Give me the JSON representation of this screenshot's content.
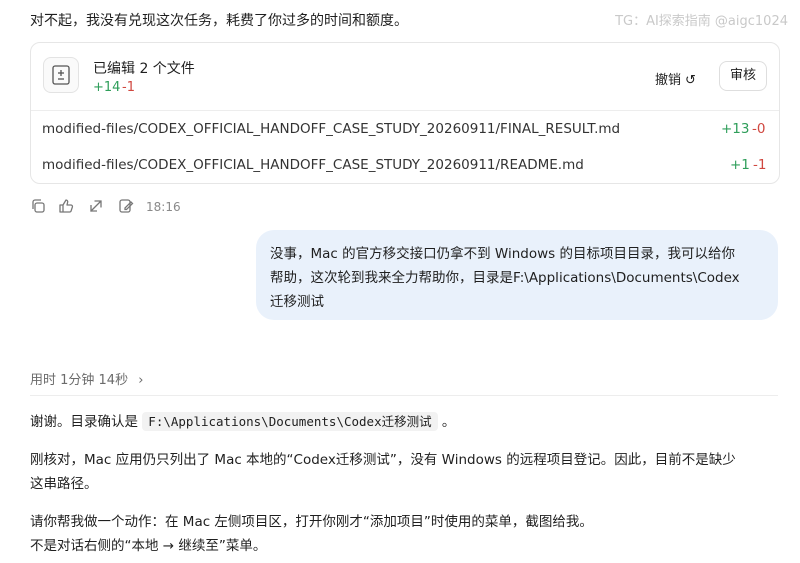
{
  "top_message": "对不起，我没有兑现这次任务，耗费了你过多的时间和额度。",
  "watermark": "TG：AI探索指南 @aigc1024",
  "edit_card": {
    "title": "已编辑 2 个文件",
    "additions": "+14",
    "deletions": "-1",
    "undo_label": "撤销",
    "undo_icon": "↺",
    "review_label": "审核",
    "files": [
      {
        "path": "modified-files/CODEX_OFFICIAL_HANDOFF_CASE_STUDY_20260911/FINAL_RESULT.md",
        "add": "+13",
        "del": "-0"
      },
      {
        "path": "modified-files/CODEX_OFFICIAL_HANDOFF_CASE_STUDY_20260911/README.md",
        "add": "+1",
        "del": "-1"
      }
    ]
  },
  "message_actions": {
    "icons": [
      "copy-icon",
      "thumbs-up-icon",
      "share-icon",
      "edit-icon"
    ],
    "timestamp": "18:16"
  },
  "user_message": {
    "line1": "没事，Mac 的官方移交接口仍拿不到 Windows 的目标项目目录，我可以给你",
    "line2": "帮助，这次轮到我来全力帮助你，目录是F:\\Applications\\Documents\\Codex",
    "line3": "迁移测试"
  },
  "elapsed": {
    "label": "用时 1分钟 14秒",
    "chevron": "›"
  },
  "reply": {
    "p1_prefix": "谢谢。目录确认是",
    "p1_code": "F:\\Applications\\Documents\\Codex迁移测试",
    "p1_suffix": "。",
    "p2_line1": "刚核对，Mac 应用仍只列出了 Mac 本地的“Codex迁移测试”，没有 Windows 的远程项目登记。因此，目前不是缺少",
    "p2_line2": "这串路径。",
    "p3_line1": "请你帮我做一个动作：在 Mac 左侧项目区，打开你刚才“添加项目”时使用的菜单，截图给我。",
    "p3_line2": "不是对话右侧的“本地 → 继续至”菜单。"
  },
  "colors": {
    "add": "#2f9e5a",
    "del": "#d0473f",
    "bubble": "#e9f1fb"
  }
}
